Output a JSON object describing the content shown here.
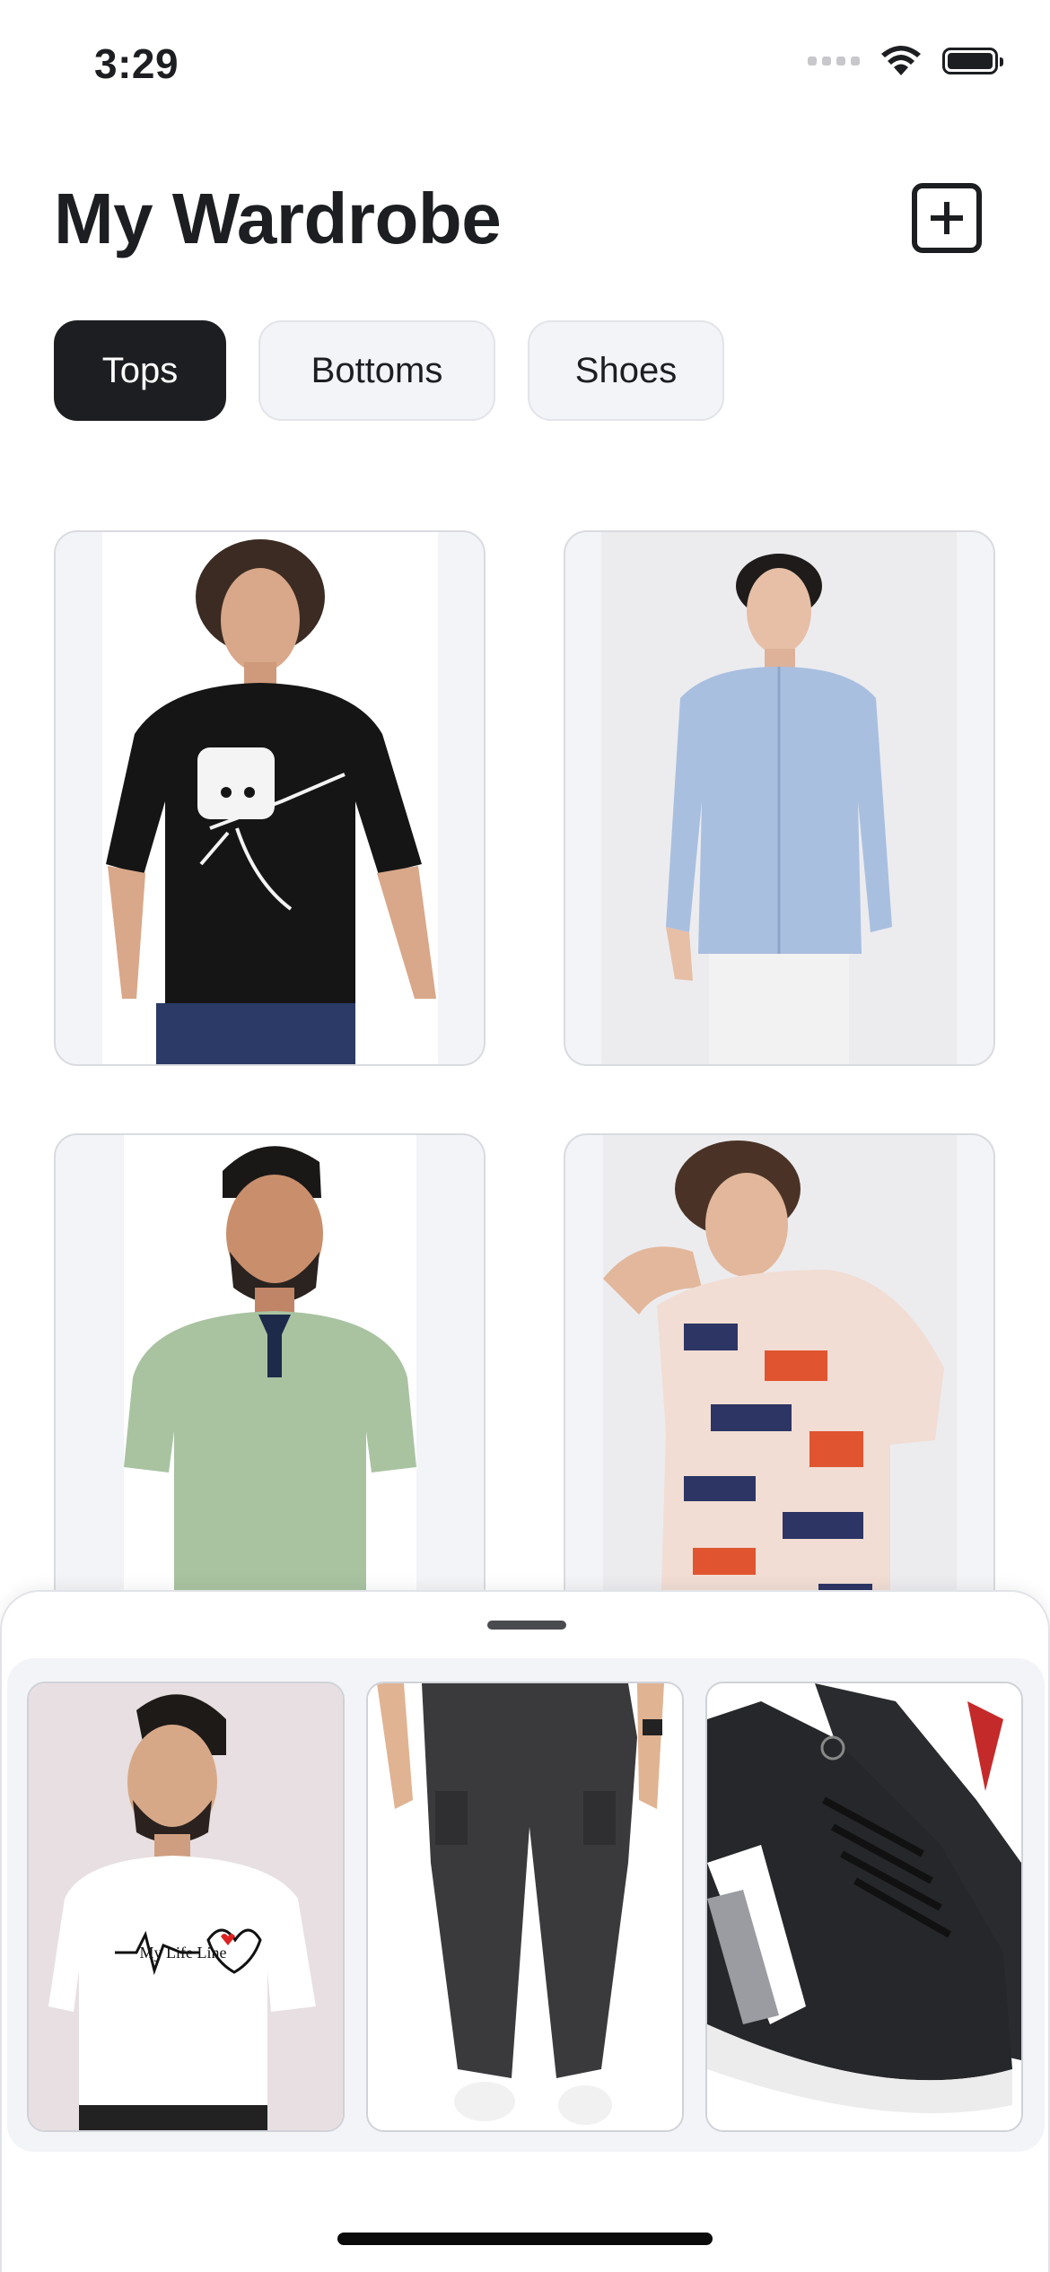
{
  "status_bar": {
    "time": "3:29"
  },
  "header": {
    "title": "My Wardrobe",
    "add_icon": "plus-square-icon"
  },
  "tabs": [
    {
      "label": "Tops",
      "active": true
    },
    {
      "label": "Bottoms",
      "active": false
    },
    {
      "label": "Shoes",
      "active": false
    }
  ],
  "wardrobe_items": [
    {
      "name": "Black graphic dab t-shirt"
    },
    {
      "name": "Light blue button-down shirt"
    },
    {
      "name": "Sage green polo shirt"
    },
    {
      "name": "Abstract print short-sleeve shirt"
    }
  ],
  "outfit_tray": {
    "items": [
      {
        "name": "White graphic t-shirt",
        "print_text": "My Life Line"
      },
      {
        "name": "Black cargo joggers"
      },
      {
        "name": "Black and white sneakers"
      }
    ]
  },
  "colors": {
    "accent": "#1d1e21",
    "chip_bg": "#f3f4f7",
    "card_border": "#d9dbe0"
  }
}
